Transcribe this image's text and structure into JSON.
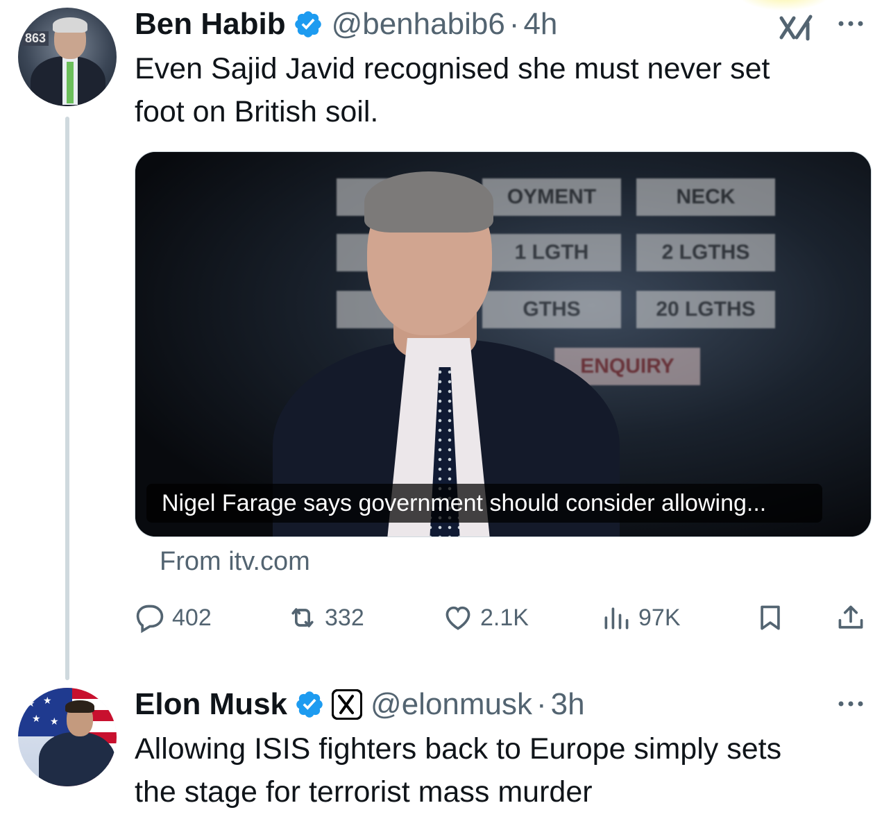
{
  "tweets": [
    {
      "author_name": "Ben Habib",
      "handle": "@benhabib6",
      "separator": "·",
      "time": "4h",
      "avatar_tag": "863",
      "text_lines": [
        "Even Sajid Javid recognised she must never set",
        "foot on British soil."
      ],
      "media": {
        "board_labels": [
          "OYMENT",
          "NECK",
          "1 LGTH",
          "2 LGTHS",
          "GTHS",
          "20 LGTHS",
          "ENQUIRY"
        ],
        "caption": "Nigel Farage says government should consider allowing..."
      },
      "source": "From itv.com",
      "stats": {
        "replies": "402",
        "retweets": "332",
        "likes": "2.1K",
        "views": "97K"
      }
    },
    {
      "author_name": "Elon Musk",
      "handle": "@elonmusk",
      "separator": "·",
      "time": "3h",
      "text_lines": [
        "Allowing ISIS fighters back to Europe simply sets",
        "the stage for terrorist mass murder"
      ]
    }
  ],
  "colors": {
    "verified": "#1d9bf0",
    "secondary_text": "#536471",
    "thread_line": "#cfd9de"
  }
}
